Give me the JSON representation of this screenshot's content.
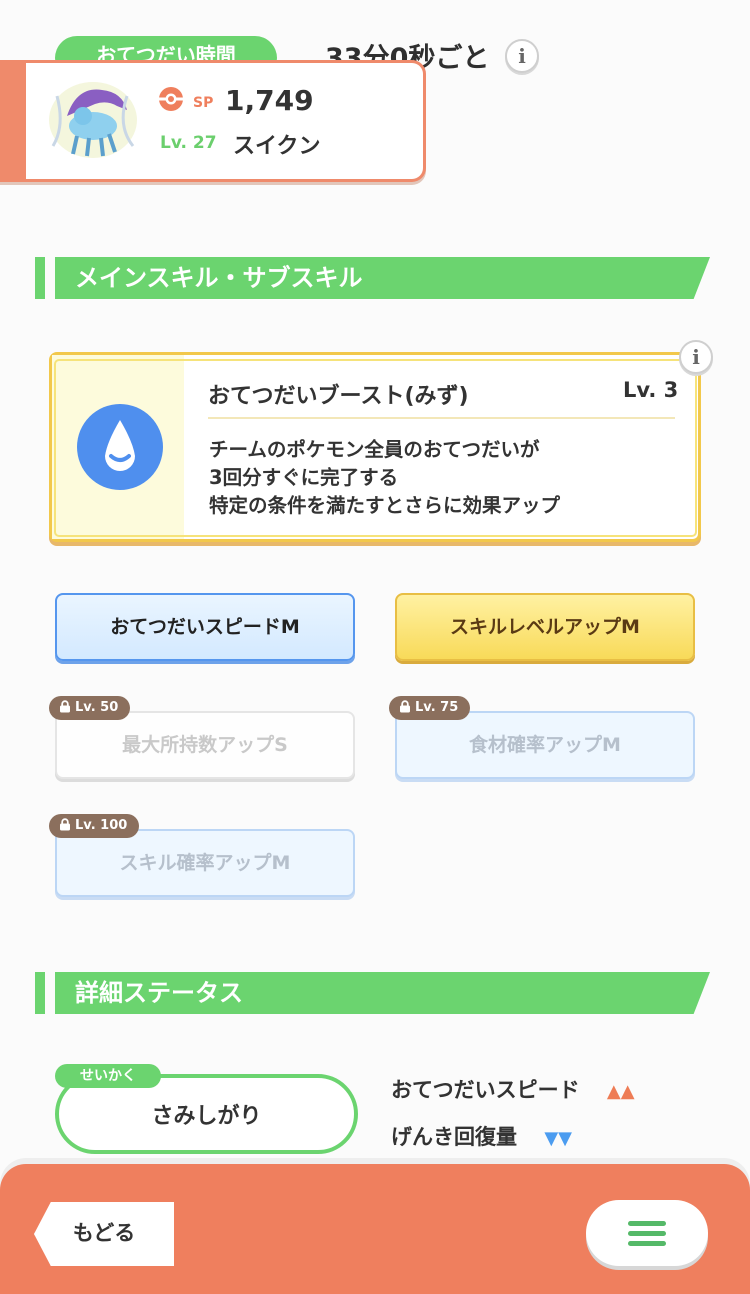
{
  "top": {
    "help_time_label": "おてつだい時間",
    "interval": "33分0秒ごと",
    "info_glyph": "i"
  },
  "pokemon": {
    "sp_label": "SP",
    "sp_value": "1,749",
    "level": "Lv. 27",
    "name": "スイクン"
  },
  "skills_section": {
    "title": "メインスキル・サブスキル",
    "main_skill": {
      "name": "おてつだいブースト(みず)",
      "level": "Lv. 3",
      "desc": [
        "チームのポケモン全員のおてつだいが",
        "3回分すぐに完了する",
        "特定の条件を満たすとさらに効果アップ"
      ],
      "icon": "water-drop-icon"
    },
    "sub_skills": [
      {
        "label": "おてつだいスピードM",
        "locked": false
      },
      {
        "label": "スキルレベルアップM",
        "locked": false
      },
      {
        "label": "最大所持数アップS",
        "locked": true,
        "unlock": "Lv. 50"
      },
      {
        "label": "食材確率アップM",
        "locked": true,
        "unlock": "Lv. 75"
      },
      {
        "label": "スキル確率アップM",
        "locked": true,
        "unlock": "Lv. 100"
      }
    ]
  },
  "status_section": {
    "title": "詳細ステータス",
    "nature_tag": "せいかく",
    "nature_value": "さみしがり",
    "up_stat": "おてつだいスピード",
    "up_arrows": "▲▲",
    "down_stat": "げんき回復量",
    "down_arrows": "▼▼"
  },
  "bottom": {
    "back_label": "もどる"
  },
  "colors": {
    "green": "#6bd46f",
    "orange": "#ef7f5e",
    "up": "#ee7c55",
    "down": "#4b9cf0"
  }
}
